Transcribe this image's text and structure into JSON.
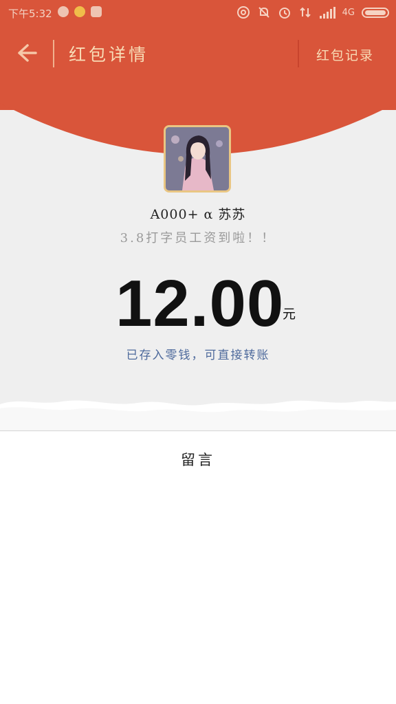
{
  "status_bar": {
    "time": "下午5:32",
    "network": "4G",
    "left_icons": [
      "app-notification-icon",
      "app-notification-icon",
      "app-notification-icon"
    ],
    "right_icons": [
      "hotspot-icon",
      "mute-icon",
      "alarm-icon",
      "data-transfer-icon",
      "signal-icon",
      "battery-icon"
    ]
  },
  "nav": {
    "back_icon": "arrow-left-icon",
    "title": "红包详情",
    "record_label": "红包记录"
  },
  "packet": {
    "sender_name": "A000+ α 苏苏",
    "memo": "3.8打字员工资到啦！！",
    "amount": "12.00",
    "unit": "元",
    "balance_note": "已存入零钱，可直接转账"
  },
  "message": {
    "label": "留言"
  },
  "colors": {
    "header_red": "#d9553a",
    "title_gold": "#f8dcb6",
    "link_blue": "#4e6a9c",
    "background_grey": "#efefef"
  }
}
